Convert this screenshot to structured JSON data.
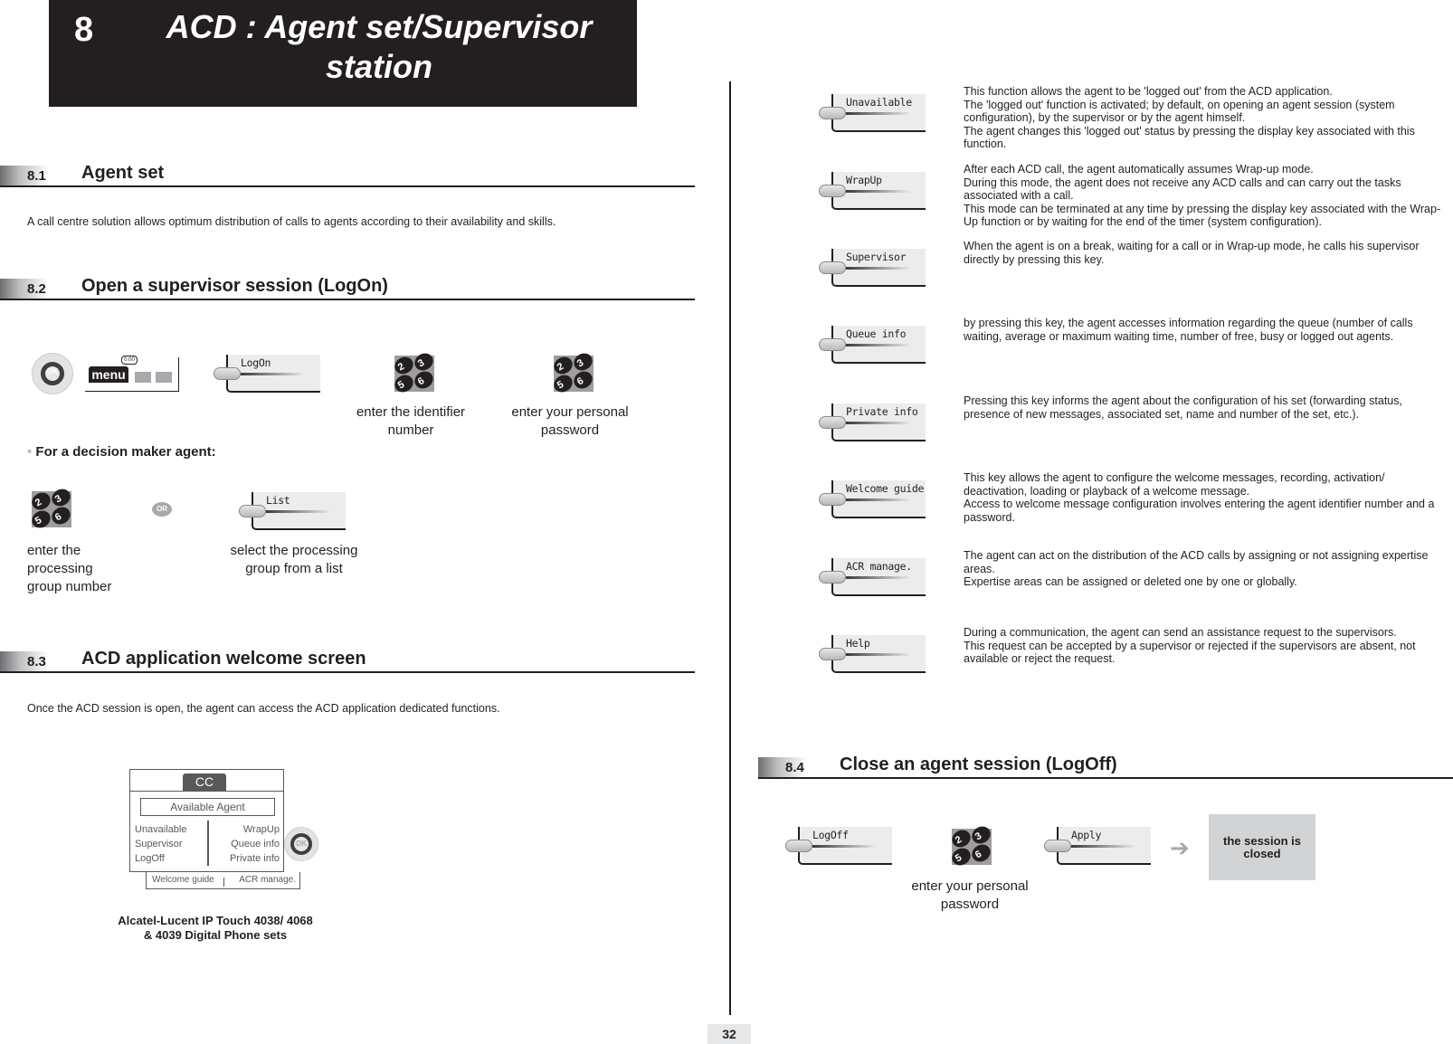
{
  "chapter": {
    "number": "8",
    "title": "ACD : Agent set/Supervisor station"
  },
  "sections": {
    "s81": {
      "number": "8.1",
      "title": "Agent set",
      "body": "A call centre solution allows optimum distribution of calls to agents according to their availability and skills."
    },
    "s82": {
      "number": "8.2",
      "title": "Open a supervisor session (LogOn)",
      "menu_label": "menu",
      "menu_time": "0:00",
      "softkey_logon": "LogOn",
      "caption_identifier": "enter the identifier number",
      "caption_password": "enter your personal password",
      "decision_heading": "For a decision maker agent:",
      "or_label": "OR",
      "softkey_list": "List",
      "caption_group_number": "enter the processing group number",
      "caption_group_list": "select the processing group from a list"
    },
    "s83": {
      "number": "8.3",
      "title": "ACD application welcome screen",
      "body": "Once the ACD session is open, the agent can access the ACD application dedicated functions.",
      "screen": {
        "tab": "CC",
        "status": "Available Agent",
        "left_items": [
          "Unavailable",
          "Supervisor",
          "LogOff"
        ],
        "right_items": [
          "WrapUp",
          "Queue info",
          "Private info"
        ],
        "bottom_left": "Welcome guide",
        "bottom_right": "ACR manage.",
        "ok_label": "OK"
      },
      "device_caption": "Alcatel-Lucent IP Touch 4038/ 4068 & 4039 Digital Phone sets"
    },
    "functions": [
      {
        "key": "Unavailable",
        "lines": [
          "This function allows the agent to be 'logged out' from the ACD application.",
          "The 'logged out' function is activated; by default, on opening an agent session (system configuration), by the supervisor or by the agent himself.",
          "The agent changes this 'logged out' status by pressing the display key associated with this function."
        ]
      },
      {
        "key": "WrapUp",
        "lines": [
          "After each ACD call, the agent automatically assumes Wrap-up mode.",
          "During this mode, the agent does not receive any ACD calls and can carry out the tasks associated with a call.",
          "This mode can be terminated at any time by pressing the display key associated with the Wrap-Up function or by waiting for the end of the timer (system configuration)."
        ]
      },
      {
        "key": "Supervisor",
        "lines": [
          "When the agent is on a break, waiting for a call or in Wrap-up mode, he calls his supervisor directly by pressing this key."
        ]
      },
      {
        "key": "Queue info",
        "lines": [
          "by pressing this key, the agent accesses information regarding the queue (number of calls waiting, average or maximum waiting time, number of free, busy or logged out agents."
        ]
      },
      {
        "key": "Private info",
        "lines": [
          "Pressing this key informs the agent about the configuration of his set (forwarding status, presence of new messages, associated set, name and number of the set, etc.)."
        ]
      },
      {
        "key": "Welcome guide",
        "lines": [
          "This key allows the agent to configure the welcome messages, recording, activation/ deactivation, loading or playback of a welcome message.",
          "Access to welcome message configuration involves entering the agent identifier number and a password."
        ]
      },
      {
        "key": "ACR manage.",
        "lines": [
          "The agent can act on the distribution of the ACD calls by assigning or not assigning expertise areas.",
          "Expertise areas can be assigned or deleted one by one or globally."
        ]
      },
      {
        "key": "Help",
        "lines": [
          "During a communication, the agent can send an assistance request to the supervisors.",
          "This request can be accepted by a supervisor or rejected if the supervisors are absent, not available or reject the request."
        ]
      }
    ],
    "s84": {
      "number": "8.4",
      "title": "Close an agent session (LogOff)",
      "softkey_logoff": "LogOff",
      "caption_password": "enter your personal password",
      "softkey_apply": "Apply",
      "result": "the session is closed"
    }
  },
  "keypad_keys": [
    "2",
    "3",
    "5",
    "6"
  ],
  "page_number": "32"
}
